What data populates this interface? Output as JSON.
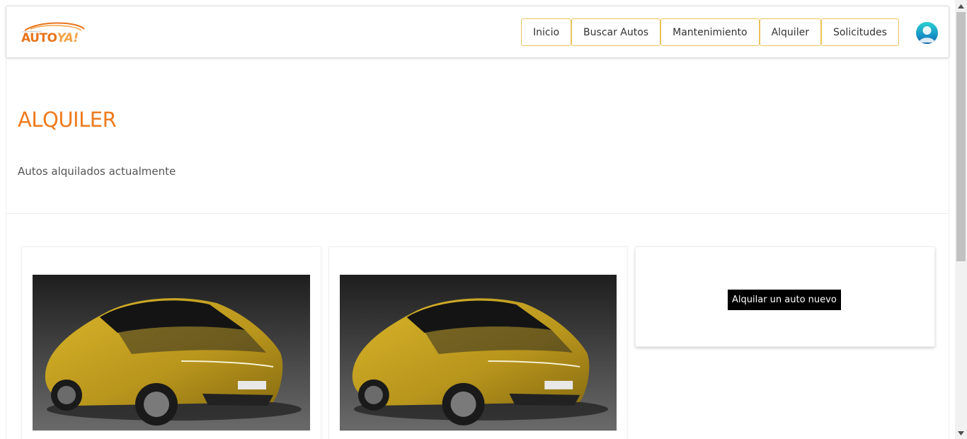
{
  "brand": {
    "logo_part1": "AUTO",
    "logo_part2": "YA!",
    "accent": "#ee7b1e",
    "nav_border": "#e9c25a"
  },
  "nav": {
    "items": [
      {
        "label": "Inicio"
      },
      {
        "label": "Buscar Autos"
      },
      {
        "label": "Mantenimiento"
      },
      {
        "label": "Alquiler"
      },
      {
        "label": "Solicitudes"
      }
    ]
  },
  "user": {
    "avatar_icon": "user-avatar-icon"
  },
  "hero": {
    "title": "ALQUILER",
    "subtitle": "Autos alquilados actualmente"
  },
  "cards": [
    {
      "image": "car-photo-yellow-sedan"
    },
    {
      "image": "car-photo-yellow-sedan"
    }
  ],
  "new_card": {
    "button_label": "Alquilar un auto nuevo"
  }
}
